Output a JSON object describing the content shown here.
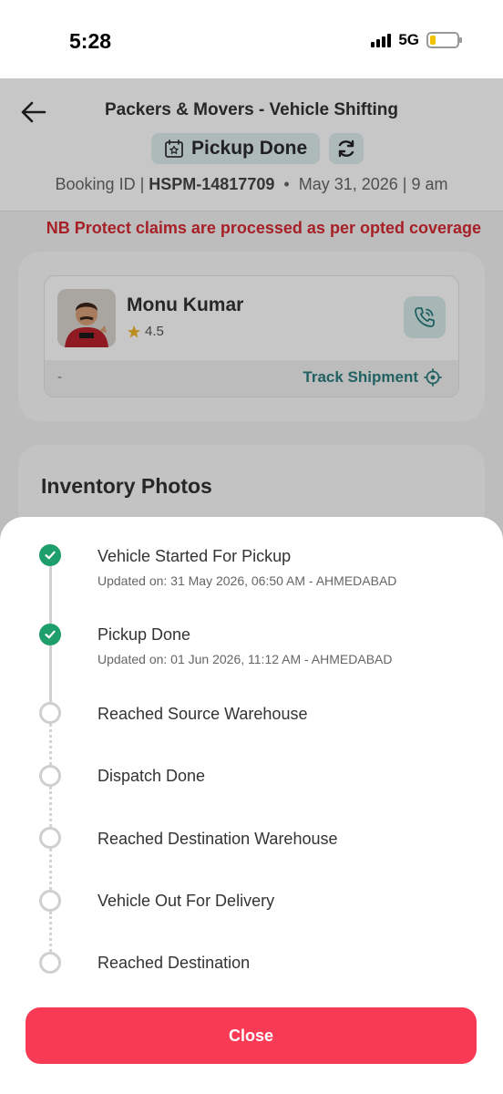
{
  "status_bar": {
    "time": "5:28",
    "network": "5G"
  },
  "header": {
    "title": "Packers & Movers - Vehicle Shifting",
    "status": "Pickup Done",
    "booking_label": "Booking ID |",
    "booking_id": "HSPM-14817709",
    "separator": "•",
    "date": "May 31, 2026 | 9 am"
  },
  "notice": "NB Protect claims are processed as per opted coverage",
  "partner": {
    "name": "Monu Kumar",
    "rating": "4.5",
    "footer_left": "-",
    "track_label": "Track Shipment"
  },
  "inventory": {
    "title": "Inventory Photos"
  },
  "timeline": [
    {
      "title": "Vehicle Started For Pickup",
      "subtitle": "Updated on: 31 May 2026, 06:50 AM - AHMEDABAD",
      "done": true
    },
    {
      "title": "Pickup Done",
      "subtitle": "Updated on: 01 Jun 2026, 11:12 AM - AHMEDABAD",
      "done": true
    },
    {
      "title": "Reached Source Warehouse",
      "subtitle": "",
      "done": false
    },
    {
      "title": "Dispatch Done",
      "subtitle": "",
      "done": false
    },
    {
      "title": "Reached Destination Warehouse",
      "subtitle": "",
      "done": false
    },
    {
      "title": "Vehicle Out For Delivery",
      "subtitle": "",
      "done": false
    },
    {
      "title": "Reached Destination",
      "subtitle": "",
      "done": false
    }
  ],
  "close_label": "Close",
  "colors": {
    "accent": "#f93a55",
    "done": "#1e9e6a",
    "notice": "#d72a33",
    "teal": "#2b7d7d"
  }
}
